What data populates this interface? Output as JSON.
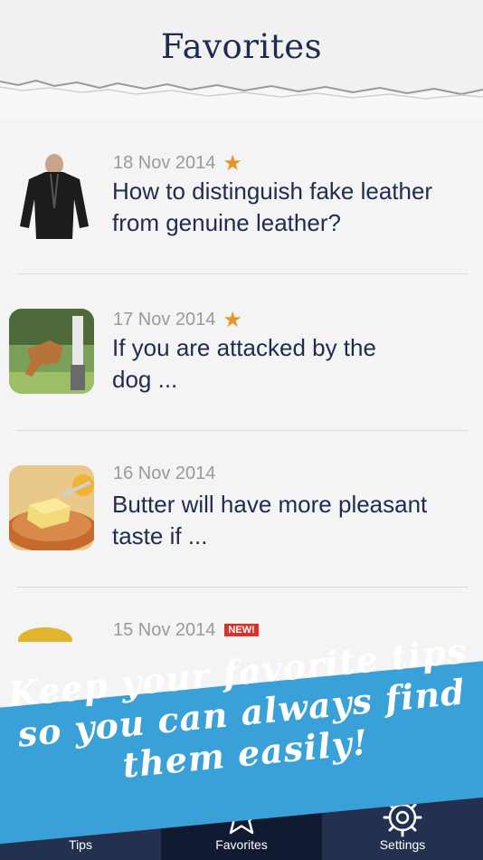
{
  "header": {
    "title": "Favorites"
  },
  "items": [
    {
      "date": "18 Nov 2014",
      "title": "How to distinguish fake leather from genuine leather?",
      "favorite": true,
      "is_new": false,
      "thumb": "leather-jacket-photo"
    },
    {
      "date": "17 Nov 2014",
      "title": "If you are attacked by the dog ...",
      "favorite": true,
      "is_new": false,
      "thumb": "dog-attack-photo"
    },
    {
      "date": "16 Nov 2014",
      "title": "Butter will have more pleasant taste if ...",
      "favorite": false,
      "is_new": false,
      "thumb": "butter-plate-photo"
    },
    {
      "date": "15 Nov 2014",
      "title": "",
      "favorite": false,
      "is_new": true,
      "new_label": "NEW!",
      "thumb": "partial-photo"
    }
  ],
  "banner": {
    "lines": [
      "Keep your favorite tips",
      "so you can always find",
      "them easily!"
    ]
  },
  "tabbar": {
    "tabs": [
      {
        "label": "Tips",
        "icon": "tips-icon",
        "active": false
      },
      {
        "label": "Favorites",
        "icon": "star-icon",
        "active": true
      },
      {
        "label": "Settings",
        "icon": "gear-icon",
        "active": false
      }
    ]
  },
  "colors": {
    "navy": "#1e2d4f",
    "star": "#e5962a",
    "banner": "#3aa0d8",
    "tabbar": "#24304f",
    "new_badge": "#d9322a"
  }
}
